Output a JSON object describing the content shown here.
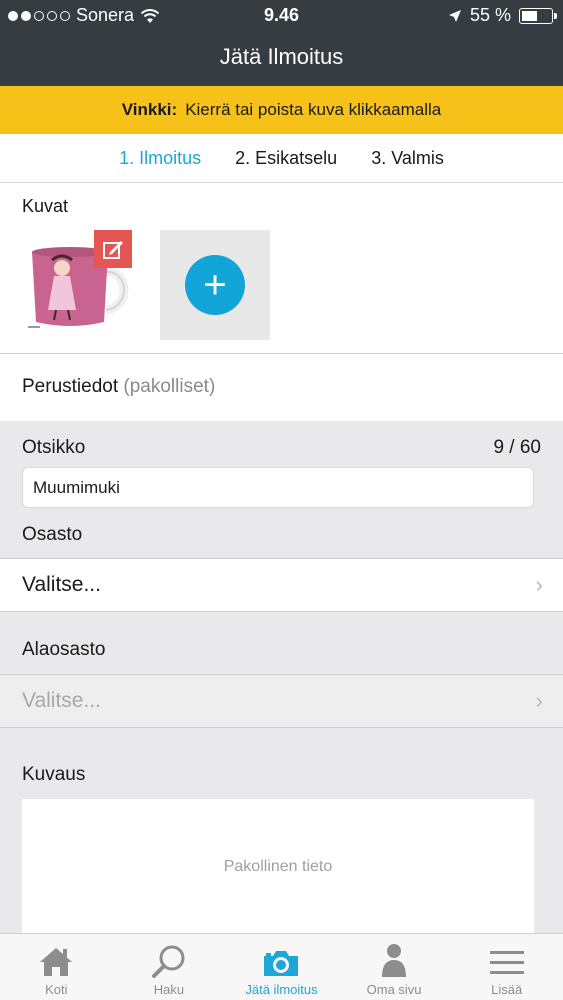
{
  "status_bar": {
    "carrier": "Sonera",
    "time": "9.46",
    "battery": "55 %",
    "battery_level": 0.55
  },
  "header": {
    "title": "Jätä Ilmoitus"
  },
  "tip": {
    "label": "Vinkki:",
    "text": "Kierrä tai poista kuva klikkaamalla"
  },
  "steps": [
    "1. Ilmoitus",
    "2. Esikatselu",
    "3. Valmis"
  ],
  "photos": {
    "label": "Kuvat"
  },
  "basic_info": {
    "label": "Perustiedot",
    "note": "(pakolliset)"
  },
  "title_field": {
    "label": "Otsikko",
    "counter": "9 / 60",
    "value": "Muumimuki"
  },
  "department": {
    "label": "Osasto",
    "value": "Valitse..."
  },
  "subdepartment": {
    "label": "Alaosasto",
    "placeholder": "Valitse..."
  },
  "description": {
    "label": "Kuvaus",
    "placeholder": "Pakollinen tieto"
  },
  "tabbar": [
    {
      "label": "Koti",
      "icon": "home-icon"
    },
    {
      "label": "Haku",
      "icon": "search-icon"
    },
    {
      "label": "Jätä ilmoitus",
      "icon": "camera-icon"
    },
    {
      "label": "Oma sivu",
      "icon": "person-icon"
    },
    {
      "label": "Lisää",
      "icon": "menu-icon"
    }
  ],
  "colors": {
    "accent": "#1ea6d6",
    "header": "#353c42",
    "tip": "#f6c21a",
    "edit": "#e55653"
  }
}
